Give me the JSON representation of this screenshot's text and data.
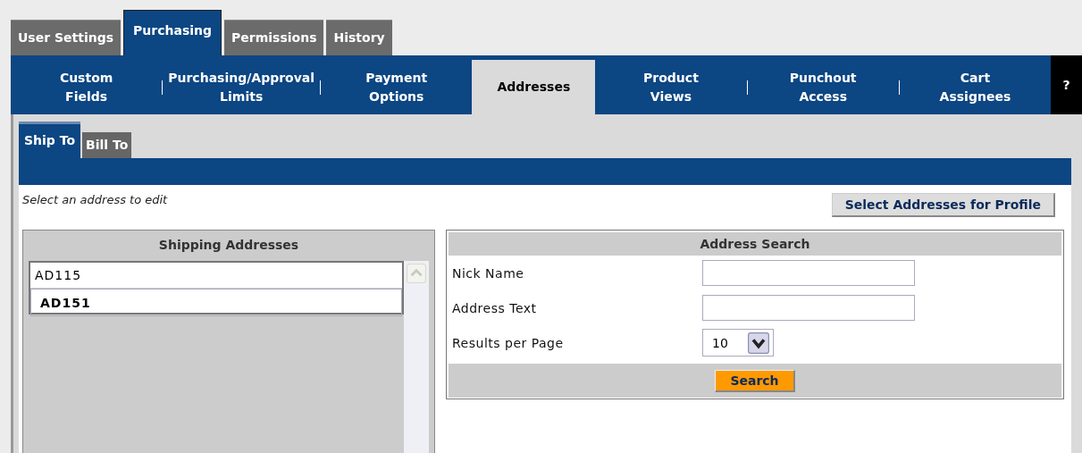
{
  "main_tabs": [
    {
      "label": "User Settings",
      "selected": false
    },
    {
      "label": "Purchasing",
      "selected": true
    },
    {
      "label": "Permissions",
      "selected": false
    },
    {
      "label": "History",
      "selected": false
    }
  ],
  "sub_tabs": [
    {
      "label": "Custom Fields",
      "selected": false
    },
    {
      "label": "Purchasing/Approval Limits",
      "selected": false
    },
    {
      "label": "Payment Options",
      "selected": false
    },
    {
      "label": "Addresses",
      "selected": true
    },
    {
      "label": "Product Views",
      "selected": false
    },
    {
      "label": "Punchout Access",
      "selected": false
    },
    {
      "label": "Cart Assignees",
      "selected": false
    }
  ],
  "help_button": "?",
  "address_tabs": [
    {
      "label": "Ship To",
      "selected": true
    },
    {
      "label": "Bill To",
      "selected": false
    }
  ],
  "hint": "Select an address to edit",
  "select_button": "Select Addresses for Profile",
  "shipping_addresses": {
    "title": "Shipping Addresses",
    "items": [
      {
        "label": "AD115",
        "selected": false
      },
      {
        "label": "AD151",
        "selected": true
      }
    ]
  },
  "address_search": {
    "title": "Address Search",
    "fields": [
      {
        "label": "Nick Name",
        "kind": "text"
      },
      {
        "label": "Address Text",
        "kind": "text"
      },
      {
        "label": "Results per Page",
        "kind": "select",
        "value": "10"
      }
    ],
    "button": "Search"
  }
}
